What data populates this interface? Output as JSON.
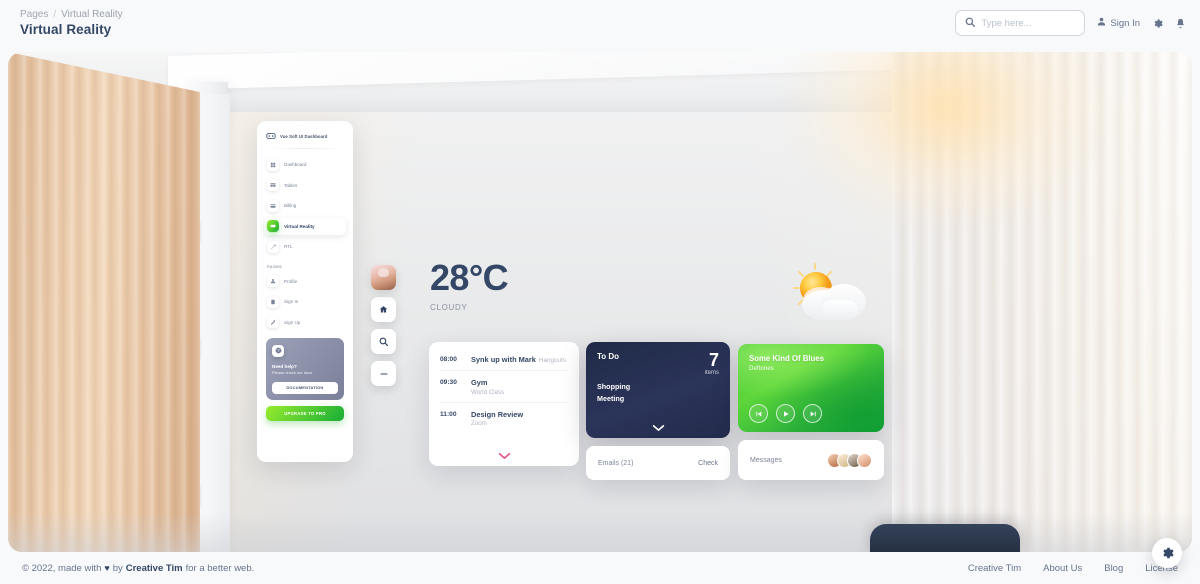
{
  "topbar": {
    "breadcrumb": {
      "root": "Pages",
      "separator": "/",
      "current": "Virtual Reality"
    },
    "page_title": "Virtual Reality",
    "search": {
      "placeholder": "Type here...",
      "value": "",
      "icon": "search-icon"
    },
    "signin_label": "Sign In",
    "icons": {
      "user": "user-icon",
      "settings": "gear-icon",
      "notifications": "bell-icon"
    }
  },
  "vr": {
    "sidebar": {
      "brand": "Vue Soft UI Dashboard",
      "items": [
        {
          "label": "Dashboard",
          "icon": "dashboard-icon",
          "active": false
        },
        {
          "label": "Tables",
          "icon": "table-icon",
          "active": false
        },
        {
          "label": "Billing",
          "icon": "credit-card-icon",
          "active": false
        },
        {
          "label": "Virtual Reality",
          "icon": "vr-icon",
          "active": true
        },
        {
          "label": "RTL",
          "icon": "rtl-icon",
          "active": false
        }
      ],
      "section_label": "PAGES",
      "account_items": [
        {
          "label": "Profile",
          "icon": "profile-icon"
        },
        {
          "label": "Sign In",
          "icon": "signin-icon"
        },
        {
          "label": "Sign Up",
          "icon": "signup-icon"
        }
      ],
      "help_card": {
        "icon": "question-icon",
        "title": "Need help?",
        "subtitle": "Please check our docs",
        "button": "DOCUMENTATION"
      },
      "upgrade_button": "UPGRADE TO PRO"
    },
    "rail": [
      {
        "name": "avatar",
        "icon": "avatar-icon"
      },
      {
        "name": "home",
        "icon": "home-icon"
      },
      {
        "name": "search",
        "icon": "search-icon"
      },
      {
        "name": "minimize",
        "icon": "minus-icon"
      }
    ],
    "temperature": {
      "value": "28°C",
      "condition": "CLOUDY",
      "icon": "sun-cloud-icon"
    },
    "schedule": {
      "events": [
        {
          "time": "08:00",
          "title": "Synk up with Mark",
          "extra": "Hangouts",
          "sub": ""
        },
        {
          "time": "09:30",
          "title": "Gym",
          "extra": "",
          "sub": "World Class"
        },
        {
          "time": "11:00",
          "title": "Design Review",
          "extra": "",
          "sub": "Zoom"
        }
      ],
      "expand_icon": "chevron-down-icon"
    },
    "todo": {
      "title": "To Do",
      "count": "7",
      "count_label": "items",
      "tasks": [
        "Shopping",
        "Meeting"
      ],
      "expand_icon": "chevron-down-icon"
    },
    "music": {
      "title": "Some Kind Of Blues",
      "artist": "Deftones",
      "controls": [
        {
          "name": "previous",
          "icon": "skip-back-icon"
        },
        {
          "name": "play",
          "icon": "play-icon"
        },
        {
          "name": "next",
          "icon": "skip-forward-icon"
        }
      ]
    },
    "emails": {
      "label": "Emails (21)",
      "action": "Check"
    },
    "messages": {
      "label": "Messages"
    }
  },
  "footer": {
    "copyright_prefix": "© 2022, made with",
    "heart": "♥",
    "copyright_by": "by",
    "author": "Creative Tim",
    "copyright_suffix": "for a better web.",
    "links": [
      "Creative Tim",
      "About Us",
      "Blog",
      "License"
    ],
    "fab_icon": "gear-icon"
  }
}
